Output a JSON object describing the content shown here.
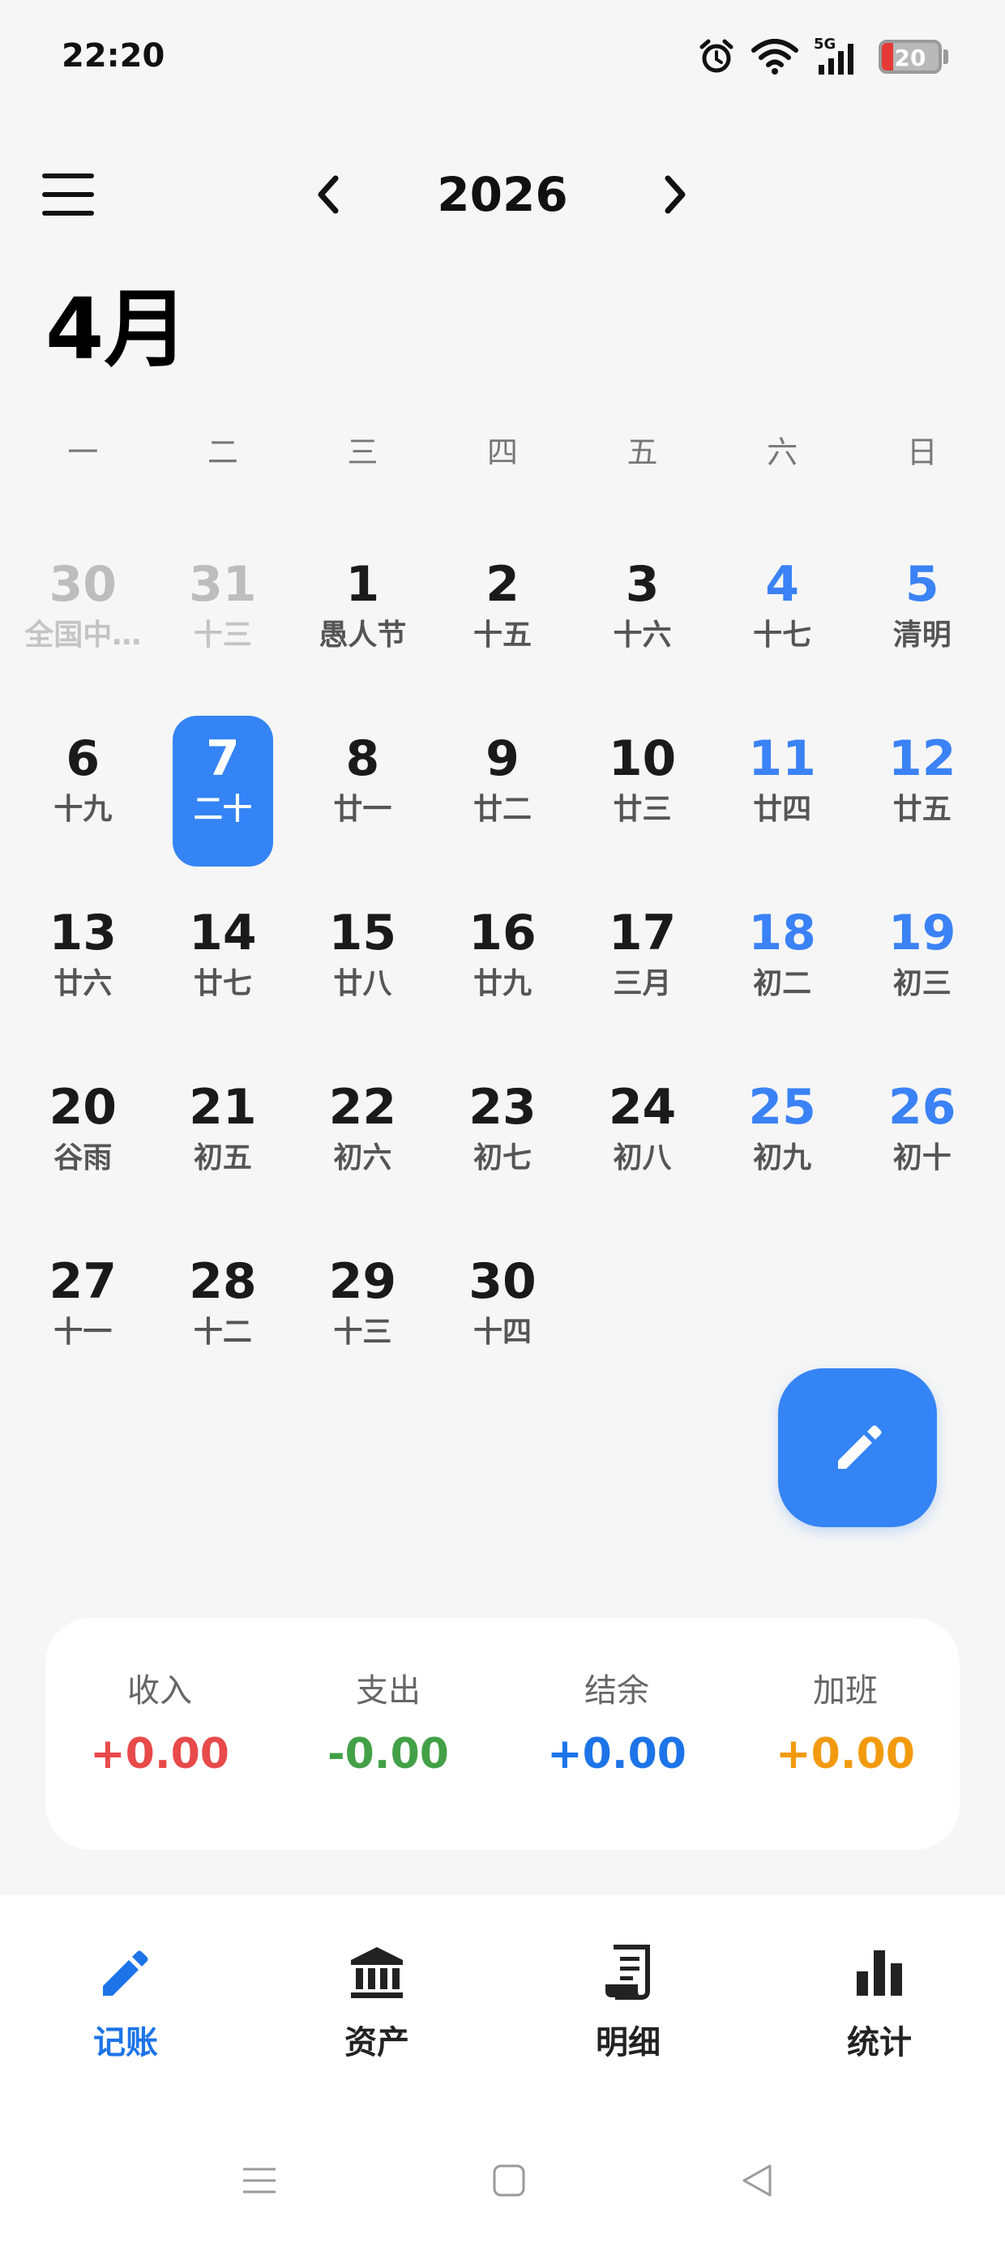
{
  "status_bar": {
    "time": "22:20",
    "battery": "20",
    "battery_level": 0.2,
    "network": "5G"
  },
  "header": {
    "year": "2026",
    "month": "4月"
  },
  "weekdays": [
    "一",
    "二",
    "三",
    "四",
    "五",
    "六",
    "日"
  ],
  "calendar": {
    "days": [
      {
        "num": "30",
        "lunar": "全国中…",
        "other": true,
        "weekend": false,
        "selected": false
      },
      {
        "num": "31",
        "lunar": "十三",
        "other": true,
        "weekend": false,
        "selected": false
      },
      {
        "num": "1",
        "lunar": "愚人节",
        "other": false,
        "weekend": false,
        "selected": false
      },
      {
        "num": "2",
        "lunar": "十五",
        "other": false,
        "weekend": false,
        "selected": false
      },
      {
        "num": "3",
        "lunar": "十六",
        "other": false,
        "weekend": false,
        "selected": false
      },
      {
        "num": "4",
        "lunar": "十七",
        "other": false,
        "weekend": true,
        "selected": false
      },
      {
        "num": "5",
        "lunar": "清明",
        "other": false,
        "weekend": true,
        "selected": false
      },
      {
        "num": "6",
        "lunar": "十九",
        "other": false,
        "weekend": false,
        "selected": false
      },
      {
        "num": "7",
        "lunar": "二十",
        "other": false,
        "weekend": false,
        "selected": true
      },
      {
        "num": "8",
        "lunar": "廿一",
        "other": false,
        "weekend": false,
        "selected": false
      },
      {
        "num": "9",
        "lunar": "廿二",
        "other": false,
        "weekend": false,
        "selected": false
      },
      {
        "num": "10",
        "lunar": "廿三",
        "other": false,
        "weekend": false,
        "selected": false
      },
      {
        "num": "11",
        "lunar": "廿四",
        "other": false,
        "weekend": true,
        "selected": false
      },
      {
        "num": "12",
        "lunar": "廿五",
        "other": false,
        "weekend": true,
        "selected": false
      },
      {
        "num": "13",
        "lunar": "廿六",
        "other": false,
        "weekend": false,
        "selected": false
      },
      {
        "num": "14",
        "lunar": "廿七",
        "other": false,
        "weekend": false,
        "selected": false
      },
      {
        "num": "15",
        "lunar": "廿八",
        "other": false,
        "weekend": false,
        "selected": false
      },
      {
        "num": "16",
        "lunar": "廿九",
        "other": false,
        "weekend": false,
        "selected": false
      },
      {
        "num": "17",
        "lunar": "三月",
        "other": false,
        "weekend": false,
        "selected": false
      },
      {
        "num": "18",
        "lunar": "初二",
        "other": false,
        "weekend": true,
        "selected": false
      },
      {
        "num": "19",
        "lunar": "初三",
        "other": false,
        "weekend": true,
        "selected": false
      },
      {
        "num": "20",
        "lunar": "谷雨",
        "other": false,
        "weekend": false,
        "selected": false
      },
      {
        "num": "21",
        "lunar": "初五",
        "other": false,
        "weekend": false,
        "selected": false
      },
      {
        "num": "22",
        "lunar": "初六",
        "other": false,
        "weekend": false,
        "selected": false
      },
      {
        "num": "23",
        "lunar": "初七",
        "other": false,
        "weekend": false,
        "selected": false
      },
      {
        "num": "24",
        "lunar": "初八",
        "other": false,
        "weekend": false,
        "selected": false
      },
      {
        "num": "25",
        "lunar": "初九",
        "other": false,
        "weekend": true,
        "selected": false
      },
      {
        "num": "26",
        "lunar": "初十",
        "other": false,
        "weekend": true,
        "selected": false
      },
      {
        "num": "27",
        "lunar": "十一",
        "other": false,
        "weekend": false,
        "selected": false
      },
      {
        "num": "28",
        "lunar": "十二",
        "other": false,
        "weekend": false,
        "selected": false
      },
      {
        "num": "29",
        "lunar": "十三",
        "other": false,
        "weekend": false,
        "selected": false
      },
      {
        "num": "30",
        "lunar": "十四",
        "other": false,
        "weekend": false,
        "selected": false
      }
    ]
  },
  "summary": [
    {
      "label": "收入",
      "value": "+0.00",
      "color": "#e84a4a"
    },
    {
      "label": "支出",
      "value": "-0.00",
      "color": "#43a047"
    },
    {
      "label": "结余",
      "value": "+0.00",
      "color": "#1d74e8"
    },
    {
      "label": "加班",
      "value": "+0.00",
      "color": "#f29a0e"
    }
  ],
  "nav": [
    {
      "label": "记账",
      "icon": "pencil-icon",
      "active": true
    },
    {
      "label": "资产",
      "icon": "bank-icon",
      "active": false
    },
    {
      "label": "明细",
      "icon": "receipt-icon",
      "active": false
    },
    {
      "label": "统计",
      "icon": "bar-chart-icon",
      "active": false
    }
  ],
  "colors": {
    "accent": "#3584f5",
    "weekend": "#3b82f6",
    "background": "#f6f6f6"
  }
}
